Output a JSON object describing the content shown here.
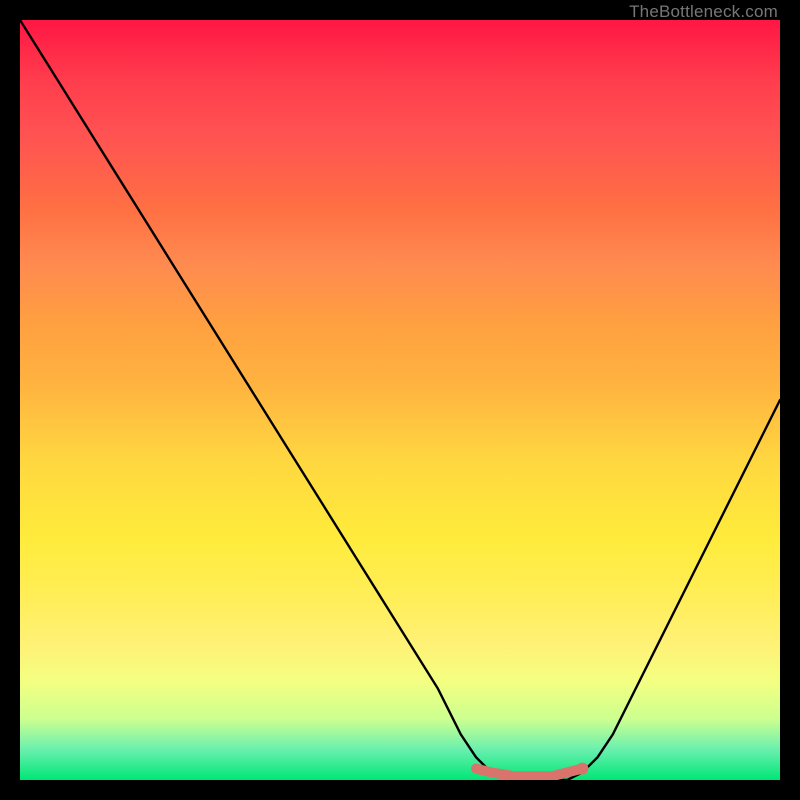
{
  "watermark": "TheBottleneck.com",
  "chart_data": {
    "type": "line",
    "title": "",
    "xlabel": "",
    "ylabel": "",
    "xlim": [
      0,
      1
    ],
    "ylim": [
      0,
      1
    ],
    "series": [
      {
        "name": "bottleneck-curve",
        "x": [
          0.0,
          0.05,
          0.1,
          0.15,
          0.2,
          0.25,
          0.3,
          0.35,
          0.4,
          0.45,
          0.5,
          0.55,
          0.58,
          0.6,
          0.62,
          0.65,
          0.68,
          0.7,
          0.72,
          0.74,
          0.76,
          0.78,
          0.8,
          0.85,
          0.9,
          0.95,
          1.0
        ],
        "values": [
          1.0,
          0.92,
          0.84,
          0.76,
          0.68,
          0.6,
          0.52,
          0.44,
          0.36,
          0.28,
          0.2,
          0.12,
          0.06,
          0.03,
          0.01,
          0.0,
          0.0,
          0.0,
          0.0,
          0.01,
          0.03,
          0.06,
          0.1,
          0.2,
          0.3,
          0.4,
          0.5
        ]
      },
      {
        "name": "optimum-marker",
        "x": [
          0.6,
          0.62,
          0.65,
          0.68,
          0.7,
          0.72,
          0.74
        ],
        "values": [
          0.015,
          0.01,
          0.005,
          0.005,
          0.005,
          0.01,
          0.015
        ]
      }
    ],
    "gradient_stops": [
      {
        "pos": 0.0,
        "color": "#ff1744"
      },
      {
        "pos": 0.5,
        "color": "#ffd740"
      },
      {
        "pos": 0.85,
        "color": "#fff176"
      },
      {
        "pos": 1.0,
        "color": "#00e676"
      }
    ]
  }
}
